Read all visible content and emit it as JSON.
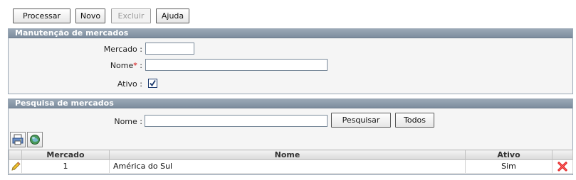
{
  "toolbar": {
    "processar": "Processar",
    "novo": "Novo",
    "excluir": "Excluir",
    "ajuda": "Ajuda"
  },
  "manutencao": {
    "title": "Manutenção de mercados",
    "mercado_label": "Mercado :",
    "mercado_value": "",
    "nome_label": "Nome",
    "nome_required": "*",
    "nome_colon": ":",
    "nome_value": "",
    "ativo_label": "Ativo :",
    "ativo_checked": true
  },
  "pesquisa": {
    "title": "Pesquisa de mercados",
    "nome_label": "Nome :",
    "nome_value": "",
    "pesquisar": "Pesquisar",
    "todos": "Todos",
    "icons": [
      "print-icon",
      "globe-icon"
    ]
  },
  "grid": {
    "columns": [
      "",
      "Mercado",
      "Nome",
      "Ativo",
      ""
    ],
    "rows": [
      {
        "edit_icon": "pencil-icon",
        "mercado": "1",
        "nome": "América do Sul",
        "ativo": "Sim",
        "delete_icon": "red-x-delete-icon"
      }
    ]
  },
  "colors": {
    "panel_header": "#8796a6",
    "required": "#d00000",
    "delete": "#e02020"
  }
}
